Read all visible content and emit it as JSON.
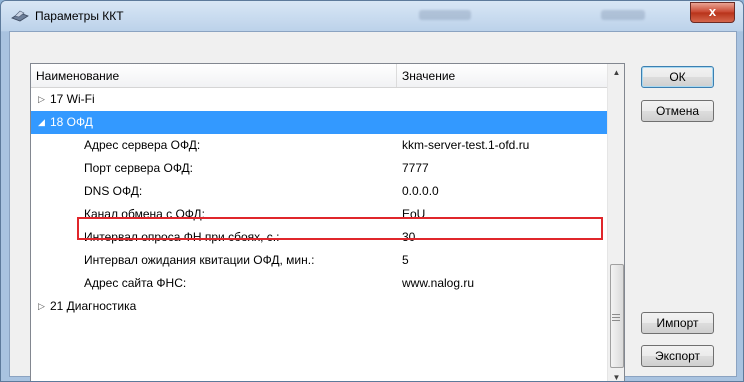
{
  "window": {
    "title": "Параметры ККТ",
    "close_symbol": "x"
  },
  "grid": {
    "columns": {
      "name": "Наименование",
      "value": "Значение"
    },
    "rows": [
      {
        "name": "17 Wi-Fi",
        "value": "",
        "expander": "▷"
      },
      {
        "name": "18 ОФД",
        "value": "",
        "expander": "◢"
      },
      {
        "name": "Адрес сервера ОФД:",
        "value": "kkm-server-test.1-ofd.ru"
      },
      {
        "name": "Порт сервера ОФД:",
        "value": "7777"
      },
      {
        "name": "DNS ОФД:",
        "value": "0.0.0.0"
      },
      {
        "name": "Канал обмена с ОФД:",
        "value": "EoU"
      },
      {
        "name": "Интервал опроса ФН при сбоях, с.:",
        "value": "30"
      },
      {
        "name": "Интервал ожидания квитации ОФД, мин.:",
        "value": "5"
      },
      {
        "name": "Адрес сайта ФНС:",
        "value": "www.nalog.ru"
      },
      {
        "name": "21 Диагностика",
        "value": "",
        "expander": "▷"
      }
    ],
    "selected_row": "18 ОФД",
    "highlighted_row": "Канал обмена с ОФД:"
  },
  "scrollbar": {
    "up": "▲",
    "down": "▼"
  },
  "buttons": {
    "ok": "ОК",
    "cancel": "Отмена",
    "import": "Импорт",
    "export": "Экспорт"
  },
  "colors": {
    "selection": "#3399ff",
    "highlight_border": "#e0262b",
    "close_button": "#c7432c"
  },
  "icons": {
    "title": "kkt-device-icon",
    "collapsed": "triangle-right-icon",
    "expanded": "triangle-down-icon"
  }
}
